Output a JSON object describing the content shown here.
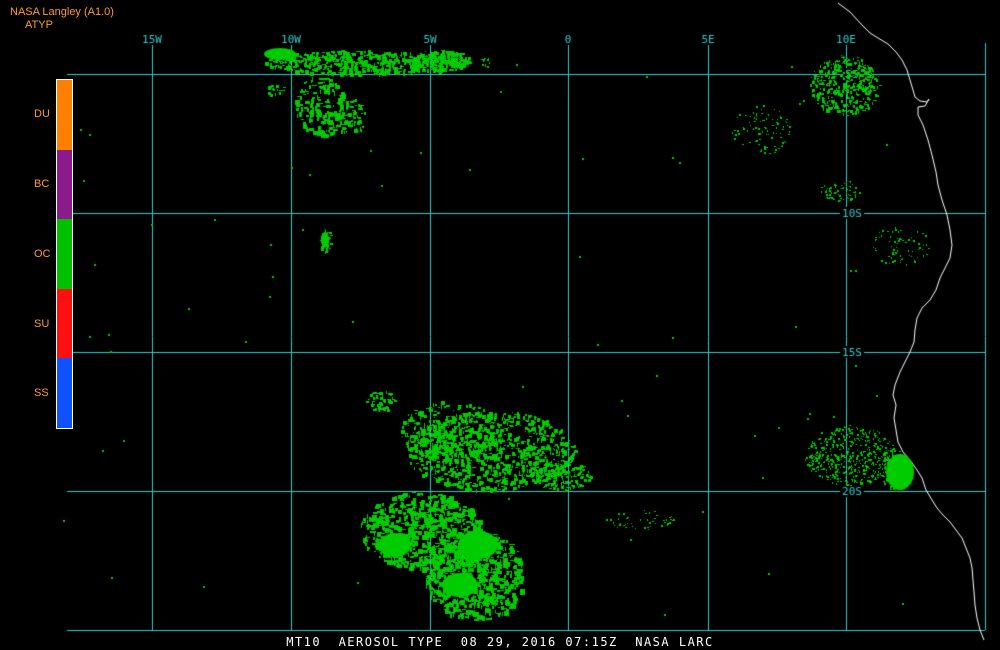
{
  "header": {
    "title": "NASA Langley (A1.0)",
    "product": "ATYP"
  },
  "legend": {
    "items": [
      {
        "code": "DU",
        "color": "#ff8000"
      },
      {
        "code": "BC",
        "color": "#8b1a8b"
      },
      {
        "code": "OC",
        "color": "#00c000"
      },
      {
        "code": "SU",
        "color": "#ff1010"
      },
      {
        "code": "SS",
        "color": "#1050ff"
      }
    ]
  },
  "map": {
    "grid_color": "#33cccc",
    "coast_color": "#ffffff",
    "aerosol_color": "#00cc00",
    "lon_labels": [
      "15W",
      "10W",
      "5W",
      "0",
      "5E",
      "10E"
    ],
    "lat_labels": [
      "5S",
      "10S",
      "15S",
      "20S"
    ]
  },
  "footer": {
    "text": "MT10  AEROSOL TYPE  08 29, 2016 07:15Z  NASA LARC"
  }
}
